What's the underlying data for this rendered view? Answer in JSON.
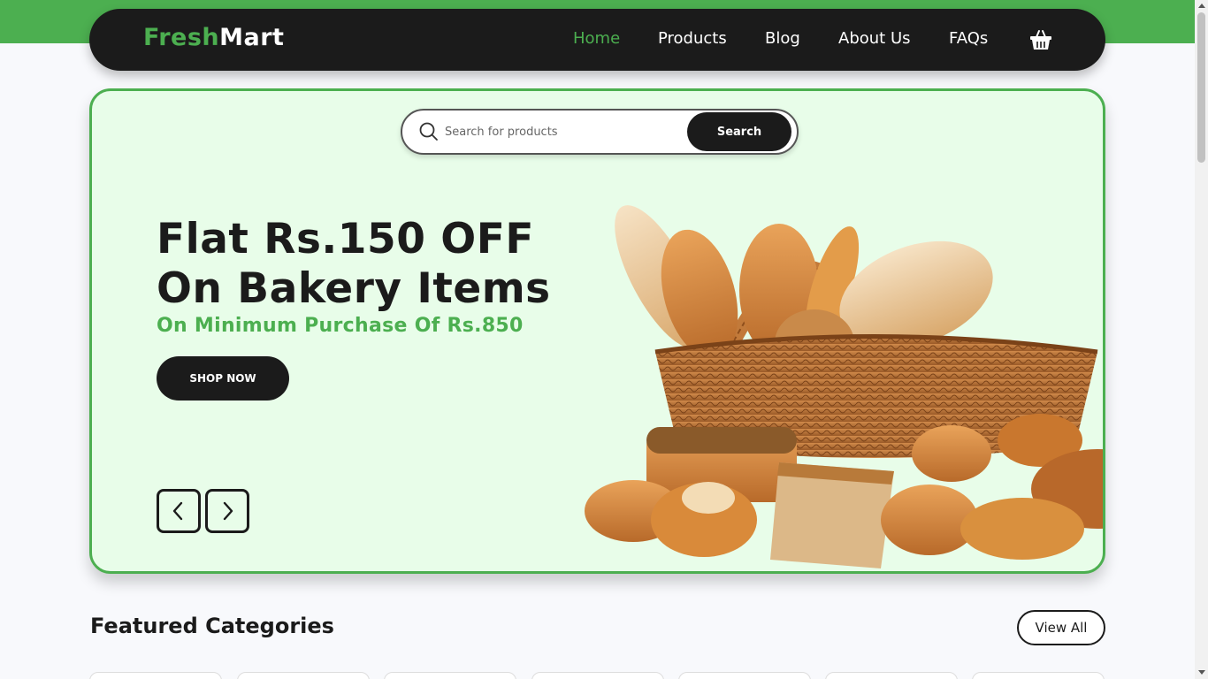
{
  "brand": {
    "part1": "Fresh",
    "part2": "Mart"
  },
  "nav": {
    "links": [
      {
        "label": "Home",
        "active": true
      },
      {
        "label": "Products",
        "active": false
      },
      {
        "label": "Blog",
        "active": false
      },
      {
        "label": "About Us",
        "active": false
      },
      {
        "label": "FAQs",
        "active": false
      }
    ],
    "cart_icon": "basket-icon"
  },
  "search": {
    "placeholder": "Search for products",
    "value": "",
    "button_label": "Search"
  },
  "hero": {
    "headline_line1": "Flat Rs.150 OFF",
    "headline_line2": "On Bakery Items",
    "subline": "On Minimum Purchase Of Rs.850",
    "cta_label": "SHOP NOW",
    "prev_icon": "chevron-left-icon",
    "next_icon": "chevron-right-icon"
  },
  "featured": {
    "title": "Featured Categories",
    "view_all_label": "View All"
  },
  "colors": {
    "accent": "#4caf50",
    "dark": "#1b1b1b",
    "hero_bg": "#e8fde9",
    "page_bg": "#f8f9fc"
  }
}
